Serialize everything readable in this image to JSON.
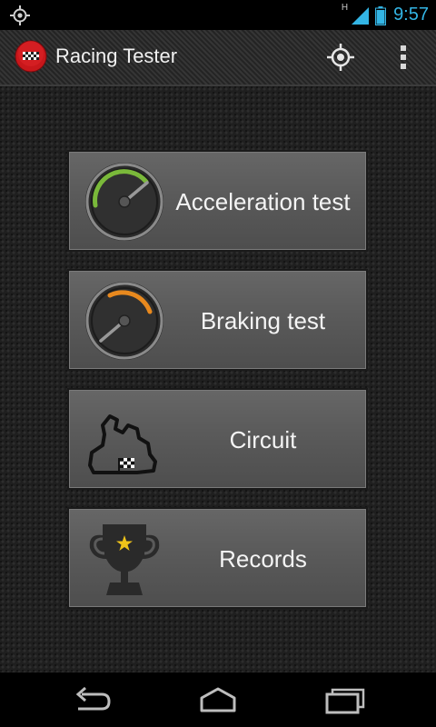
{
  "status_bar": {
    "time": "9:57",
    "network_type": "H",
    "left_icon": "gps-icon",
    "signal_icon": "signal-icon",
    "battery_icon": "battery-icon"
  },
  "action_bar": {
    "title": "Racing Tester",
    "logo_icon": "checkered-flag-logo-icon",
    "actions": [
      {
        "name": "locate-icon"
      },
      {
        "name": "overflow-menu-icon"
      }
    ]
  },
  "menu": [
    {
      "label": "Acceleration test",
      "icon": "speedometer-green-icon",
      "accent": "#7ab93a"
    },
    {
      "label": "Braking test",
      "icon": "speedometer-orange-icon",
      "accent": "#e8891e"
    },
    {
      "label": "Circuit",
      "icon": "race-track-icon"
    },
    {
      "label": "Records",
      "icon": "trophy-icon",
      "accent": "#f0c419"
    }
  ],
  "nav_bar": {
    "buttons": [
      {
        "name": "back-icon"
      },
      {
        "name": "home-icon"
      },
      {
        "name": "recent-apps-icon"
      }
    ]
  },
  "colors": {
    "status_accent": "#33b5e5",
    "button_face": "#5a5a5a",
    "background": "#1f1f1f"
  }
}
